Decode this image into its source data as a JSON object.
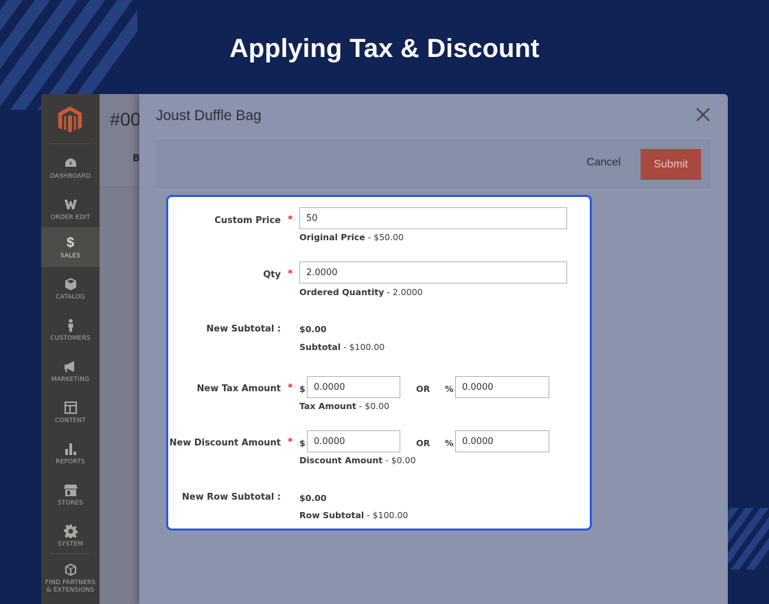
{
  "headline": "Applying Tax & Discount",
  "sidebar": {
    "items": [
      {
        "label": "DASHBOARD",
        "icon": "dashboard-icon"
      },
      {
        "label": "ORDER EDIT",
        "icon": "order-edit-icon"
      },
      {
        "label": "SALES",
        "icon": "dollar-icon",
        "active": true
      },
      {
        "label": "CATALOG",
        "icon": "box-icon"
      },
      {
        "label": "CUSTOMERS",
        "icon": "person-icon"
      },
      {
        "label": "MARKETING",
        "icon": "megaphone-icon"
      },
      {
        "label": "CONTENT",
        "icon": "layout-icon"
      },
      {
        "label": "REPORTS",
        "icon": "bar-chart-icon"
      },
      {
        "label": "STORES",
        "icon": "storefront-icon"
      },
      {
        "label": "SYSTEM",
        "icon": "gear-icon"
      },
      {
        "label": "FIND PARTNERS & EXTENSIONS",
        "label_line1": "FIND PARTNERS",
        "label_line2": "& EXTENSIONS",
        "icon": "cube-icon"
      }
    ]
  },
  "page": {
    "order_number": "#00",
    "sub_label": "B"
  },
  "modal": {
    "title": "Joust Duffle Bag",
    "cancel_label": "Cancel",
    "submit_label": "Submit"
  },
  "form": {
    "custom_price": {
      "label": "Custom Price",
      "value": "50",
      "note_label": "Original Price",
      "note_value": " - $50.00"
    },
    "qty": {
      "label": "Qty",
      "value": "2.0000",
      "note_label": "Ordered Quantity",
      "note_value": " - 2.0000"
    },
    "new_subtotal": {
      "label": "New Subtotal :",
      "value": "$0.00",
      "note_label": "Subtotal",
      "note_value": " - $100.00"
    },
    "new_tax": {
      "label": "New Tax Amount",
      "currency_symbol": "$",
      "amount": "0.0000",
      "or_label": "OR",
      "percent_symbol": "%",
      "percent": "0.0000",
      "note_label": "Tax Amount",
      "note_value": " - $0.00"
    },
    "new_discount": {
      "label": "New Discount Amount",
      "currency_symbol": "$",
      "amount": "0.0000",
      "or_label": "OR",
      "percent_symbol": "%",
      "percent": "0.0000",
      "note_label": "Discount Amount",
      "note_value": " - $0.00"
    },
    "new_row_subtotal": {
      "label": "New Row Subtotal :",
      "value": "$0.00",
      "note_label": "Row Subtotal",
      "note_value": " - $100.00"
    },
    "required_mark": "*"
  },
  "colors": {
    "background": "#112255",
    "highlight_border": "#2b56e4",
    "submit": "#a9483e",
    "required": "#e02b27"
  }
}
